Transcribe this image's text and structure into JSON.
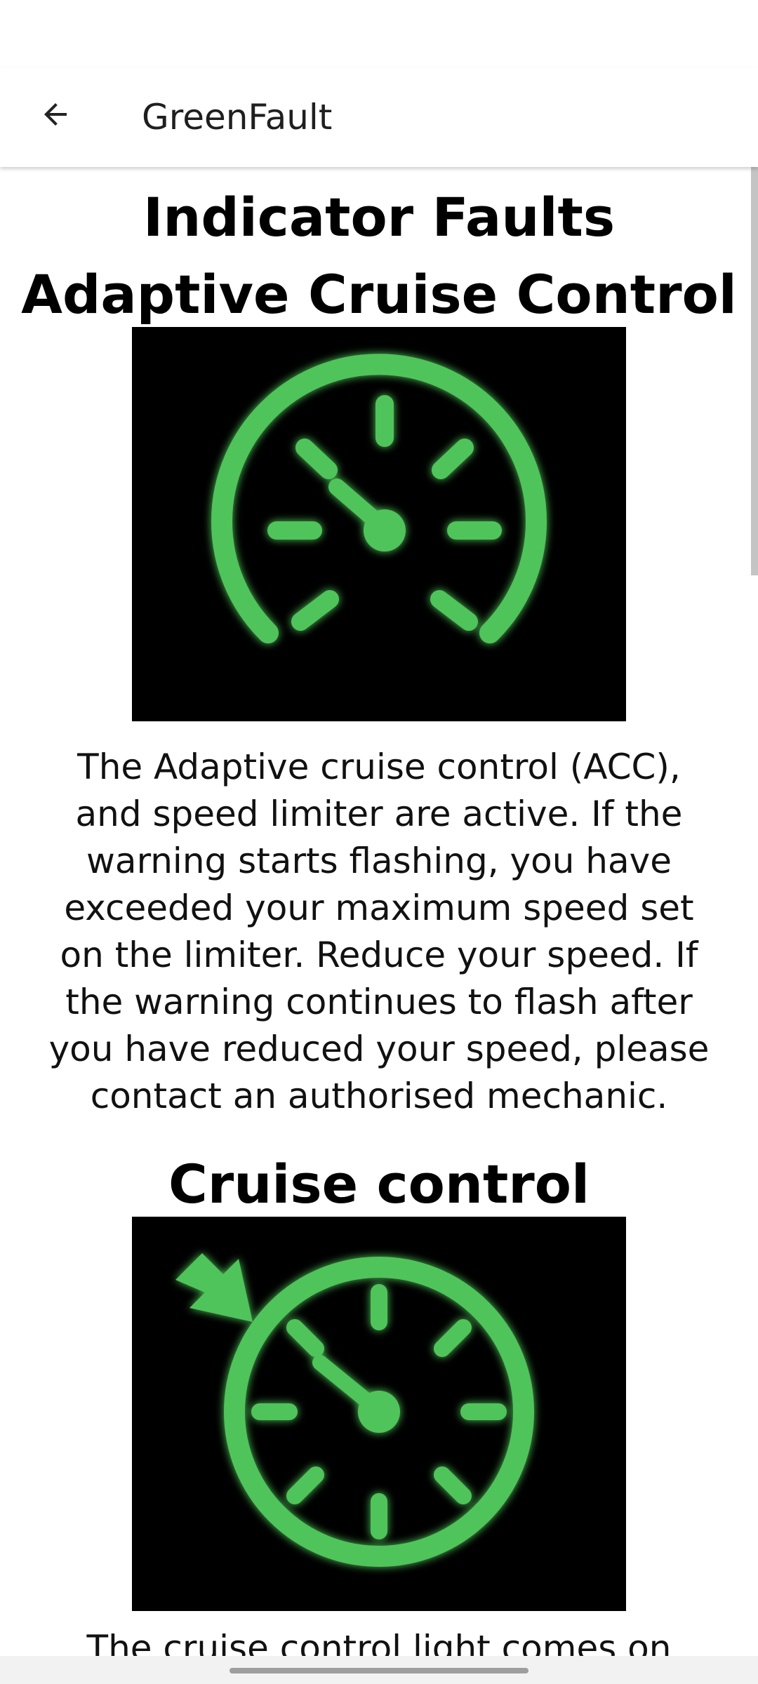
{
  "app_bar": {
    "title": "GreenFault",
    "back_icon": "arrow-left-icon"
  },
  "page": {
    "title": "Indicator Faults",
    "sections": [
      {
        "heading": "Adaptive Cruise Control",
        "image_icon": "speedometer-warning-light",
        "description": "The Adaptive cruise control (ACC), and speed limiter are active. If the warning starts flashing, you have exceeded your maximum speed set on the limiter. Reduce your speed. If the warning continues to flash after you have reduced your speed, please contact an authorised mechanic."
      },
      {
        "heading": "Cruise control",
        "image_icon": "cruise-control-warning-light",
        "description": "The cruise control light comes on"
      }
    ]
  },
  "colors": {
    "indicator_green": "#4fc45a",
    "image_background": "#000000"
  }
}
